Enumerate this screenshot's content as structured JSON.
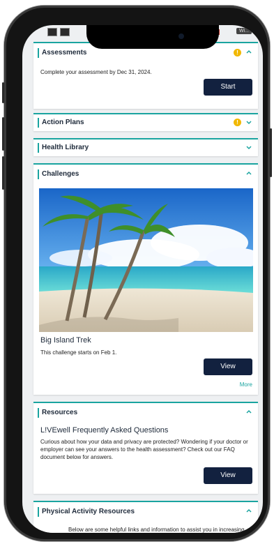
{
  "status": {
    "right_label": "Wi..."
  },
  "assessments": {
    "title": "Assessments",
    "message": "Complete your assessment by Dec 31, 2024.",
    "button": "Start"
  },
  "action_plans": {
    "title": "Action Plans"
  },
  "health_library": {
    "title": "Health Library"
  },
  "challenges": {
    "title": "Challenges",
    "challenge_name": "Big Island Trek",
    "challenge_info": "This challenge starts on Feb 1.",
    "button": "View",
    "more_link": "More"
  },
  "resources": {
    "title": "Resources",
    "heading": "L!VEwell Frequently Asked Questions",
    "body": "Curious about how your data and privacy are protected? Wondering if your doctor or employer can see your answers to the health assessment? Check out our FAQ document below for answers.",
    "button": "View"
  },
  "physical_activity": {
    "title": "Physical Activity Resources",
    "body": "Below are some helpful links and information to assist you in increasing"
  },
  "colors": {
    "accent": "#1aa4a0",
    "button": "#12213f",
    "warning": "#f1b800"
  }
}
